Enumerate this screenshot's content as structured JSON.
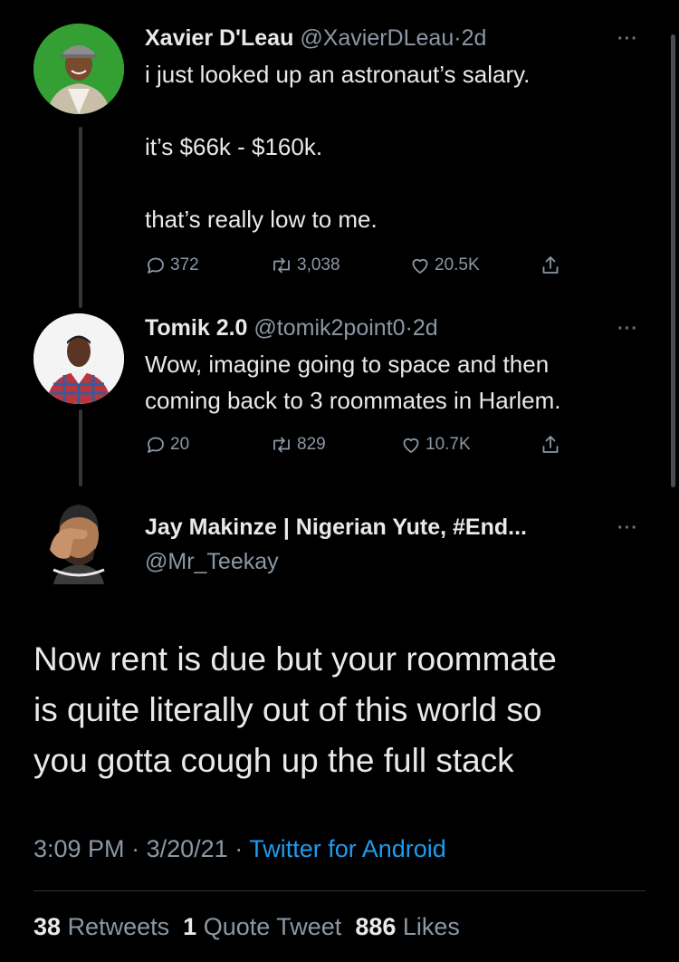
{
  "tweets": [
    {
      "name": "Xavier D'Leau",
      "handle": "@XavierDLeau",
      "separator": "·",
      "time": "2d",
      "lines": [
        "i just looked up an astronaut’s salary.",
        "it’s $66k - $160k.",
        "that’s really low to me."
      ],
      "replies": "372",
      "retweets": "3,038",
      "likes": "20.5K"
    },
    {
      "name": "Tomik 2.0",
      "handle": "@tomik2point0",
      "separator": "·",
      "time": "2d",
      "lines": [
        "Wow, imagine going to space and then",
        "coming back to 3 roommates in Harlem."
      ],
      "replies": "20",
      "retweets": "829",
      "likes": "10.7K"
    }
  ],
  "main_tweet": {
    "name": "Jay Makinze | Nigerian Yute, #End...",
    "handle": "@Mr_Teekay",
    "lines": [
      "Now rent is due but your roommate",
      "is quite literally out of this world so",
      "you gotta cough up the full stack"
    ],
    "time": "3:09 PM",
    "date": "3/20/21",
    "separator": "·",
    "source": "Twitter for Android",
    "retweets_count": "38",
    "retweets_label": "Retweets",
    "quote_count": "1",
    "quote_label": "Quote Tweet",
    "likes_count": "886",
    "likes_label": "Likes"
  },
  "more_label": "···",
  "colors": {
    "background": "#000000",
    "text": "#e7e9ea",
    "secondary": "#8b98a5",
    "link": "#1d9bf0"
  },
  "icons": [
    "reply-icon",
    "retweet-icon",
    "like-icon",
    "share-icon",
    "more-icon"
  ]
}
